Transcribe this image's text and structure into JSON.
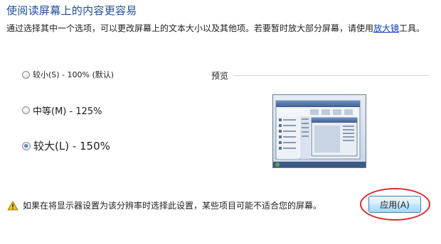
{
  "header": {
    "title": "使阅读屏幕上的内容更容易"
  },
  "description": {
    "text_before_link": "通过选择其中一个选项，可以更改屏幕上的文本大小以及其他项。若要暂时放大部分屏幕，请使用",
    "link_label": "放大镜",
    "text_after_link": "工具。"
  },
  "options": [
    {
      "label": "较小(S) - 100% (默认)",
      "checked": false
    },
    {
      "label": "中等(M) - 125%",
      "checked": false
    },
    {
      "label": "较大(L) - 150%",
      "checked": true
    }
  ],
  "preview": {
    "label": "预览"
  },
  "footer": {
    "warning_text": "如果在将显示器设置为该分辨率时选择此设置，某些项目可能不适合您的屏幕。",
    "apply_label": "应用(A)"
  },
  "colors": {
    "title": "#1e4e9a",
    "link": "#0a3fbf",
    "highlight_ellipse": "#e02a2a",
    "warning_icon": "#f2c21b"
  },
  "icons": {
    "warning": "warning-triangle-icon"
  }
}
